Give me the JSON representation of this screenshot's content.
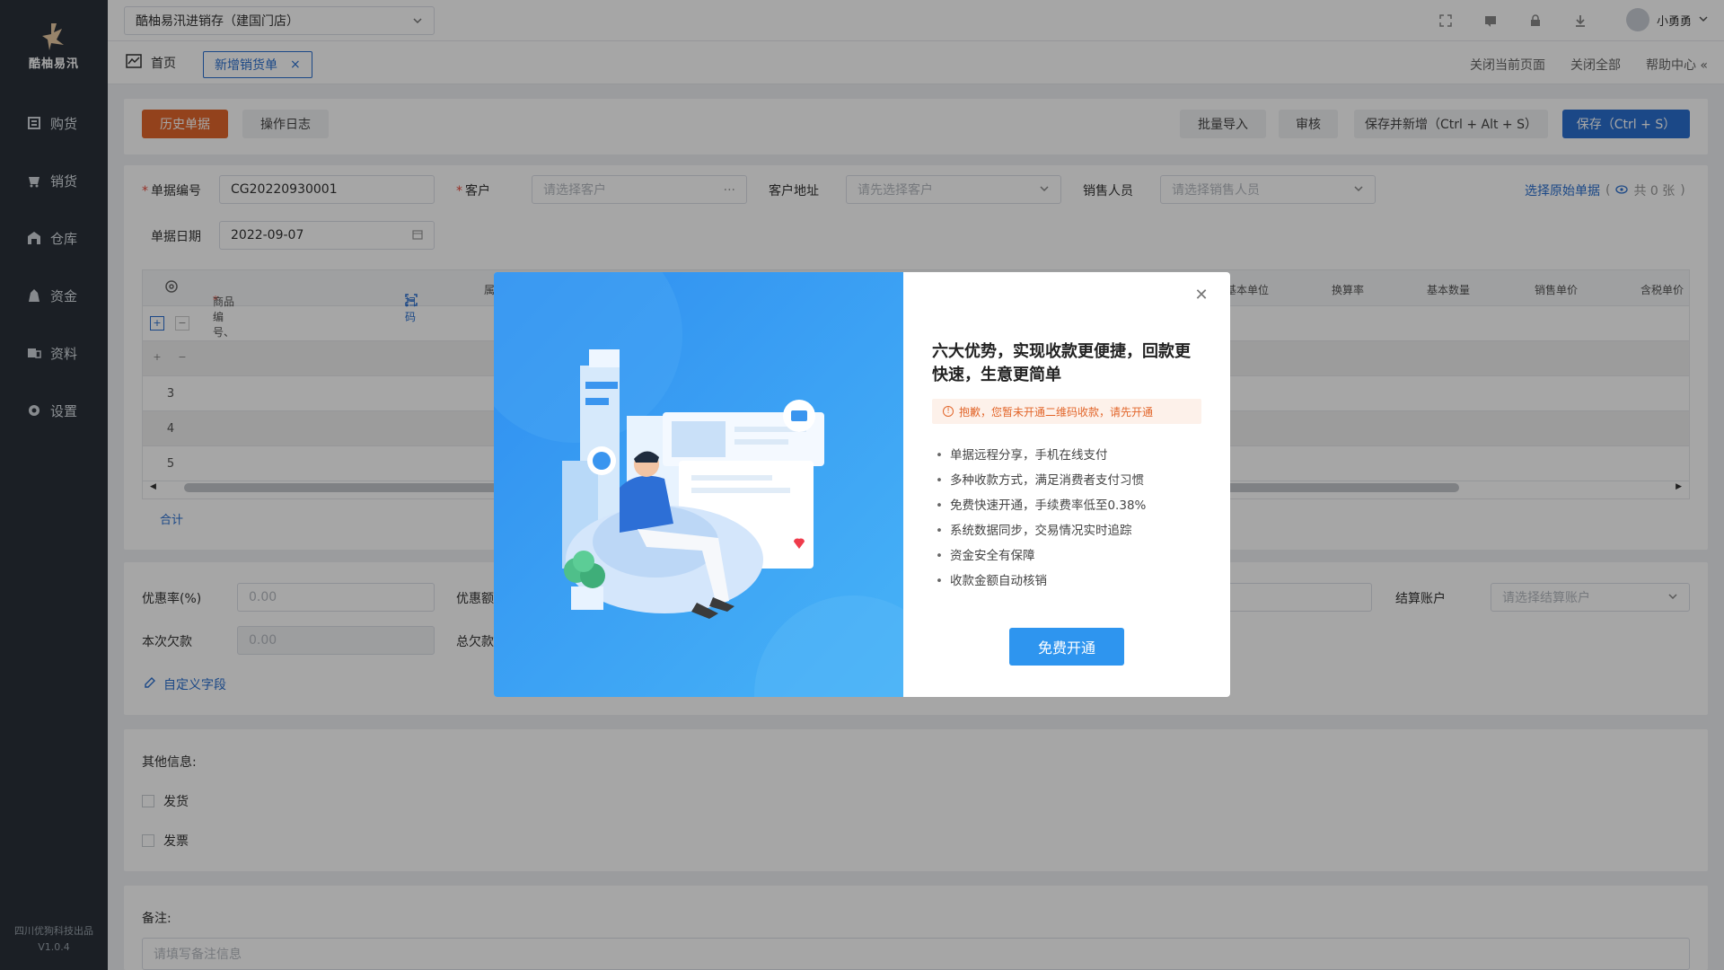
{
  "sidebar": {
    "logo_text": "酷柚易汛",
    "items": [
      {
        "label": "购货",
        "icon": "purchase-icon"
      },
      {
        "label": "销货",
        "icon": "sales-icon"
      },
      {
        "label": "仓库",
        "icon": "warehouse-icon"
      },
      {
        "label": "资金",
        "icon": "funds-icon"
      },
      {
        "label": "资料",
        "icon": "data-icon"
      },
      {
        "label": "设置",
        "icon": "settings-icon"
      }
    ],
    "footer_company": "四川优狗科技出品",
    "footer_version": "V1.0.4"
  },
  "topbar": {
    "store": "酷柚易汛进销存（建国门店）",
    "user_name": "小勇勇"
  },
  "tabs": {
    "home": "首页",
    "active": "新增销货单",
    "close_current": "关闭当前页面",
    "close_all": "关闭全部",
    "help": "帮助中心"
  },
  "toolbar": {
    "history": "历史单据",
    "log": "操作日志",
    "batch_import": "批量导入",
    "audit": "审核",
    "save_new": "保存并新增（Ctrl + Alt + S）",
    "save": "保存（Ctrl + S）"
  },
  "form": {
    "doc_no_label": "单据编号",
    "doc_no_value": "CG20220930001",
    "customer_label": "客户",
    "customer_placeholder": "请选择客户",
    "address_label": "客户地址",
    "address_placeholder": "请先选择客户",
    "salesman_label": "销售人员",
    "salesman_placeholder": "请选择销售人员",
    "source_link": "选择原始单据",
    "source_count": "共 0 张",
    "date_label": "单据日期",
    "date_value": "2022-09-07"
  },
  "grid": {
    "headers": {
      "product": "商品编号、名称",
      "scan": "扫码",
      "col3": "属",
      "base_unit": "基本单位",
      "rate": "换算率",
      "base_qty": "基本数量",
      "price": "销售单价",
      "tax_price": "含税单价"
    },
    "row_numbers": [
      "3",
      "4",
      "5"
    ],
    "total_label": "合计"
  },
  "bottom": {
    "discount_rate_label": "优惠率(%)",
    "discount_rate_value": "0.00",
    "discount_amt_label": "优惠额",
    "settle_label": "结算账户",
    "settle_placeholder": "请选择结算账户",
    "debt_label": "本次欠款",
    "debt_value": "0.00",
    "total_debt_label": "总欠款",
    "custom_fields": "自定义字段"
  },
  "other": {
    "title": "其他信息:",
    "ship": "发货",
    "invoice": "发票"
  },
  "remark": {
    "title": "备注:",
    "placeholder": "请填写备注信息"
  },
  "modal": {
    "title": "六大优势，实现收款更便捷，回款更快速，生意更简单",
    "warning": "抱歉，您暂未开通二维码收款，请先开通",
    "features": [
      "单据远程分享，手机在线支付",
      "多种收款方式，满足消费者支付习惯",
      "免费快速开通，手续费率低至0.38%",
      "系统数据同步，交易情况实时追踪",
      "资金安全有保障",
      "收款金额自动核销"
    ],
    "button": "免费开通"
  },
  "colors": {
    "sidebar_bg": "#2a3139",
    "primary": "#2a6fcf",
    "orange": "#e2662b",
    "modal_blue": "#3b9ef0"
  }
}
